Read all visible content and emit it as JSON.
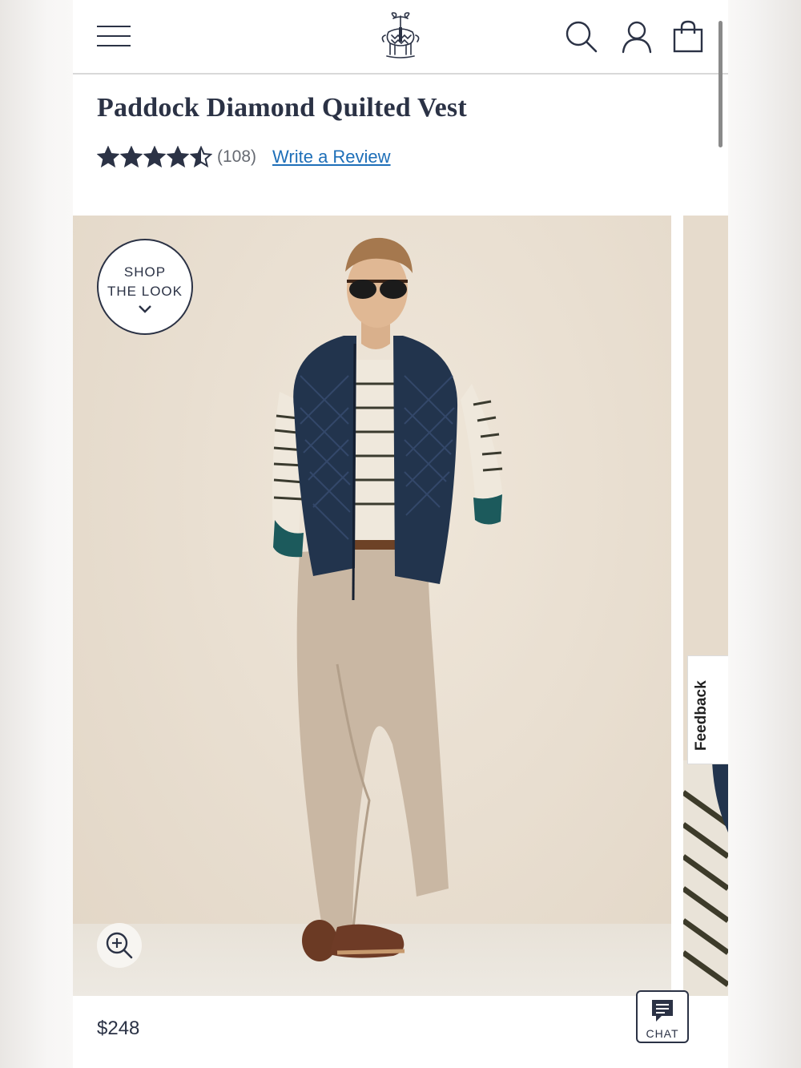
{
  "header": {
    "menu_icon": "hamburger-icon",
    "logo_icon": "golden-fleece-logo",
    "search_icon": "search-icon",
    "account_icon": "user-icon",
    "bag_icon": "shopping-bag-icon"
  },
  "product": {
    "title": "Paddock Diamond Quilted Vest",
    "rating": 4.5,
    "rating_max": 5,
    "review_count": "(108)",
    "write_review": "Write a Review",
    "price": "$248"
  },
  "gallery": {
    "shop_the_look_line1": "SHOP",
    "shop_the_look_line2": "THE LOOK",
    "zoom_icon": "zoom-in-icon"
  },
  "feedback_tab": "Feedback",
  "chat": {
    "label": "CHAT",
    "icon": "chat-bubble-icon"
  },
  "colors": {
    "navy": "#2b3245",
    "link": "#1e6fb8"
  }
}
